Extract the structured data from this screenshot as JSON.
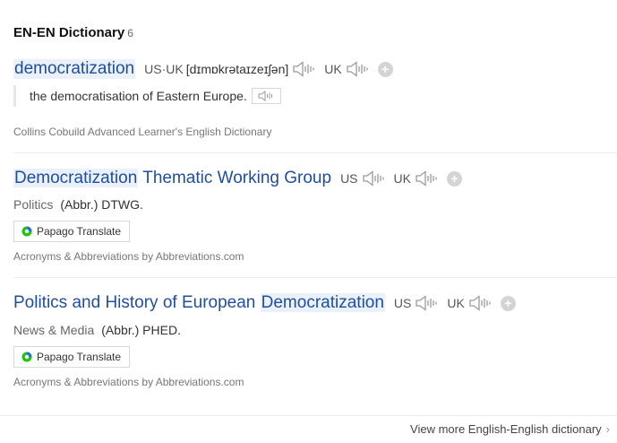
{
  "header": {
    "title": "EN-EN Dictionary",
    "count": "6"
  },
  "entries": [
    {
      "word": "democratization",
      "us_uk_label": "US·UK",
      "pronunciation": "[dɪmɒkrətaɪzeɪʃən]",
      "uk_label": "UK",
      "example": "the democratisation of Eastern Europe.",
      "source": "Collins Cobuild Advanced Learner's English Dictionary"
    },
    {
      "word_highlight": "Democratization",
      "word_rest": " Thematic Working Group",
      "us_label": "US",
      "uk_label": "UK",
      "category": "Politics",
      "meaning": "(Abbr.) DTWG.",
      "translate_label": "Papago Translate",
      "source": "Acronyms & Abbreviations by Abbreviations.com"
    },
    {
      "word_prefix": "Politics and History of European ",
      "word_highlight": "Democratization",
      "us_label": "US",
      "uk_label": "UK",
      "category": "News & Media",
      "meaning": "(Abbr.) PHED.",
      "translate_label": "Papago Translate",
      "source": "Acronyms & Abbreviations by Abbreviations.com"
    }
  ],
  "footer": {
    "more_label": "View more English-English dictionary"
  },
  "icons": {
    "speaker": "speaker-icon",
    "add": "plus-icon",
    "chevron": "chevron-right-icon",
    "papago": "papago-logo-icon"
  },
  "colors": {
    "headword": "#1f4e9e",
    "highlight": "#eaf1fb"
  }
}
